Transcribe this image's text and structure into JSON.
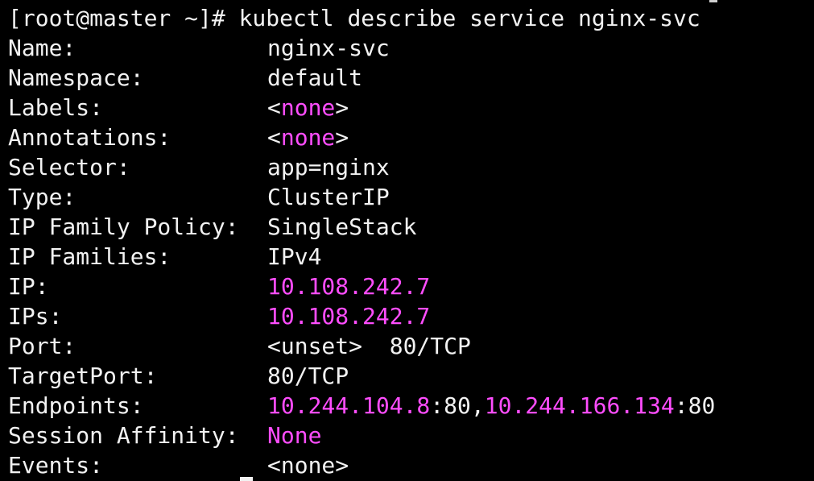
{
  "terminal": {
    "prompt": "[root@master ~]#",
    "command": "kubectl describe service nginx-svc",
    "rows": [
      {
        "key": "Name:",
        "parts": [
          {
            "text": "nginx-svc",
            "magenta": false
          }
        ]
      },
      {
        "key": "Namespace:",
        "parts": [
          {
            "text": "default",
            "magenta": false
          }
        ]
      },
      {
        "key": "Labels:",
        "parts": [
          {
            "text": "<",
            "magenta": false
          },
          {
            "text": "none",
            "magenta": true
          },
          {
            "text": ">",
            "magenta": false
          }
        ]
      },
      {
        "key": "Annotations:",
        "parts": [
          {
            "text": "<",
            "magenta": false
          },
          {
            "text": "none",
            "magenta": true
          },
          {
            "text": ">",
            "magenta": false
          }
        ]
      },
      {
        "key": "Selector:",
        "parts": [
          {
            "text": "app=nginx",
            "magenta": false
          }
        ]
      },
      {
        "key": "Type:",
        "parts": [
          {
            "text": "ClusterIP",
            "magenta": false
          }
        ]
      },
      {
        "key": "IP Family Policy:",
        "parts": [
          {
            "text": "SingleStack",
            "magenta": false
          }
        ]
      },
      {
        "key": "IP Families:",
        "parts": [
          {
            "text": "IPv4",
            "magenta": false
          }
        ]
      },
      {
        "key": "IP:",
        "parts": [
          {
            "text": "10.108.242.7",
            "magenta": true
          }
        ]
      },
      {
        "key": "IPs:",
        "parts": [
          {
            "text": "10.108.242.7",
            "magenta": true
          }
        ]
      },
      {
        "key": "Port:",
        "parts": [
          {
            "text": "<unset>  80/TCP",
            "magenta": false
          }
        ]
      },
      {
        "key": "TargetPort:",
        "parts": [
          {
            "text": "80/TCP",
            "magenta": false
          }
        ]
      },
      {
        "key": "Endpoints:",
        "parts": [
          {
            "text": "10.244.104.8",
            "magenta": true
          },
          {
            "text": ":80,",
            "magenta": false
          },
          {
            "text": "10.244.166.134",
            "magenta": true
          },
          {
            "text": ":80",
            "magenta": false
          }
        ]
      },
      {
        "key": "Session Affinity:",
        "parts": [
          {
            "text": "None",
            "magenta": true
          }
        ]
      },
      {
        "key": "Events:",
        "parts": [
          {
            "text": "<",
            "magenta": false
          },
          {
            "text": "none",
            "magenta": false
          },
          {
            "text": ">",
            "magenta": false
          }
        ]
      }
    ]
  },
  "colors": {
    "background": "#000000",
    "foreground": "#f2f2f2",
    "highlight": "#ff4dff"
  }
}
